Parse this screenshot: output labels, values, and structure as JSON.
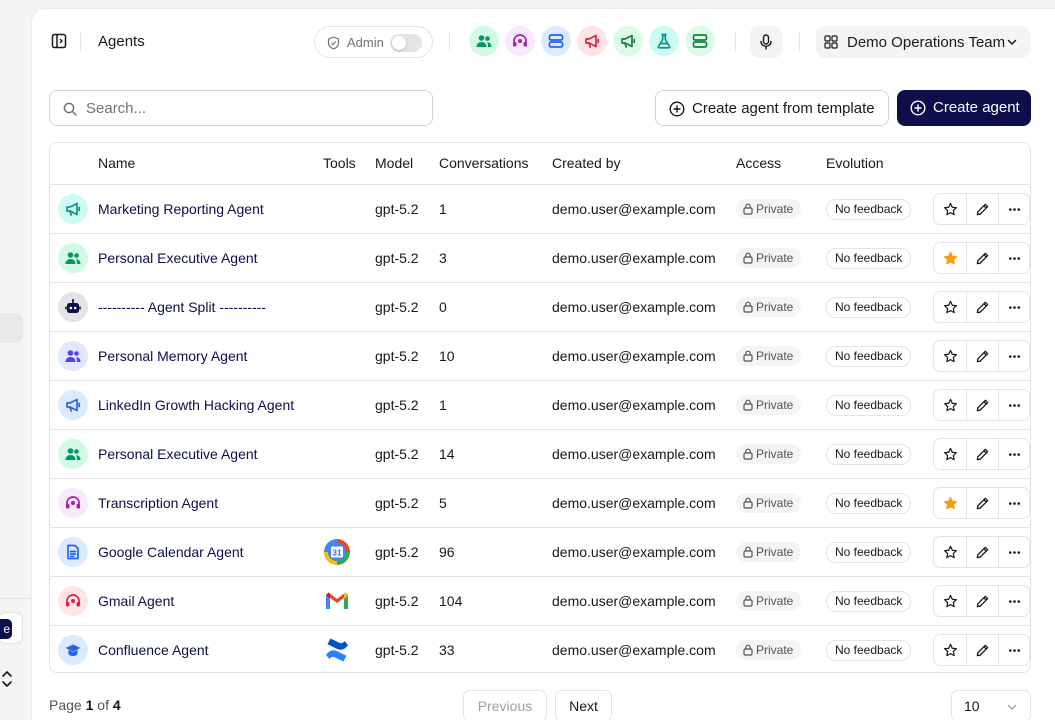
{
  "header": {
    "title": "Agents",
    "admin_label": "Admin",
    "admin_enabled": false,
    "team_name": "Demo Operations Team",
    "agent_shortcuts": [
      {
        "icon": "people-icon",
        "bg": "#d1fae5",
        "fg": "#059669"
      },
      {
        "icon": "headset-icon",
        "bg": "#fae8ff",
        "fg": "#a21caf"
      },
      {
        "icon": "server-icon",
        "bg": "#dbeafe",
        "fg": "#2563eb"
      },
      {
        "icon": "megaphone-icon",
        "bg": "#ffe4e6",
        "fg": "#e11d48"
      },
      {
        "icon": "megaphone-icon",
        "bg": "#dcfce7",
        "fg": "#15803d"
      },
      {
        "icon": "flask-icon",
        "bg": "#ccfbf1",
        "fg": "#0d9488"
      },
      {
        "icon": "server-icon",
        "bg": "#dcfce7",
        "fg": "#15803d"
      }
    ]
  },
  "toolbar": {
    "search_placeholder": "Search...",
    "template_button": "Create agent from template",
    "create_button": "Create agent"
  },
  "table": {
    "columns": {
      "name": "Name",
      "tools": "Tools",
      "model": "Model",
      "conversations": "Conversations",
      "created_by": "Created by",
      "access": "Access",
      "evolution": "Evolution"
    },
    "rows": [
      {
        "name": "Marketing Reporting Agent",
        "icon": "megaphone-icon",
        "icon_bg": "#ccfbf1",
        "icon_fg": "#0d9488",
        "tool": "",
        "model": "gpt-5.2",
        "conversations": "1",
        "created_by": "demo.user@example.com",
        "access": "Private",
        "evolution": "No feedback",
        "favorite": false
      },
      {
        "name": "Personal Executive Agent",
        "icon": "people-icon",
        "icon_bg": "#d1fae5",
        "icon_fg": "#059669",
        "tool": "",
        "model": "gpt-5.2",
        "conversations": "3",
        "created_by": "demo.user@example.com",
        "access": "Private",
        "evolution": "No feedback",
        "favorite": true
      },
      {
        "name": "---------- Agent Split ----------",
        "icon": "robot-icon",
        "icon_bg": "#e4e4e7",
        "icon_fg": "#0b0f4a",
        "tool": "",
        "model": "gpt-5.2",
        "conversations": "0",
        "created_by": "demo.user@example.com",
        "access": "Private",
        "evolution": "No feedback",
        "favorite": false
      },
      {
        "name": "Personal Memory Agent",
        "icon": "people-icon",
        "icon_bg": "#e0e7ff",
        "icon_fg": "#4f46e5",
        "tool": "",
        "model": "gpt-5.2",
        "conversations": "10",
        "created_by": "demo.user@example.com",
        "access": "Private",
        "evolution": "No feedback",
        "favorite": false
      },
      {
        "name": "LinkedIn Growth Hacking Agent",
        "icon": "megaphone-icon",
        "icon_bg": "#dbeafe",
        "icon_fg": "#2563eb",
        "tool": "",
        "model": "gpt-5.2",
        "conversations": "1",
        "created_by": "demo.user@example.com",
        "access": "Private",
        "evolution": "No feedback",
        "favorite": false
      },
      {
        "name": "Personal Executive Agent",
        "icon": "people-icon",
        "icon_bg": "#d1fae5",
        "icon_fg": "#059669",
        "tool": "",
        "model": "gpt-5.2",
        "conversations": "14",
        "created_by": "demo.user@example.com",
        "access": "Private",
        "evolution": "No feedback",
        "favorite": false
      },
      {
        "name": "Transcription Agent",
        "icon": "headset-icon",
        "icon_bg": "#fae8ff",
        "icon_fg": "#a21caf",
        "tool": "",
        "model": "gpt-5.2",
        "conversations": "5",
        "created_by": "demo.user@example.com",
        "access": "Private",
        "evolution": "No feedback",
        "favorite": true
      },
      {
        "name": "Google Calendar Agent",
        "icon": "document-icon",
        "icon_bg": "#dbeafe",
        "icon_fg": "#2563eb",
        "tool": "google-calendar-icon",
        "model": "gpt-5.2",
        "conversations": "96",
        "created_by": "demo.user@example.com",
        "access": "Private",
        "evolution": "No feedback",
        "favorite": false
      },
      {
        "name": "Gmail Agent",
        "icon": "headset-icon",
        "icon_bg": "#ffe4e6",
        "icon_fg": "#e11d48",
        "tool": "gmail-icon",
        "model": "gpt-5.2",
        "conversations": "104",
        "created_by": "demo.user@example.com",
        "access": "Private",
        "evolution": "No feedback",
        "favorite": false
      },
      {
        "name": "Confluence Agent",
        "icon": "graduation-cap-icon",
        "icon_bg": "#dbeafe",
        "icon_fg": "#2563eb",
        "tool": "confluence-icon",
        "model": "gpt-5.2",
        "conversations": "33",
        "created_by": "demo.user@example.com",
        "access": "Private",
        "evolution": "No feedback",
        "favorite": false
      }
    ]
  },
  "pagination": {
    "page_prefix": "Page",
    "current_page": "1",
    "of_label": "of",
    "total_pages": "4",
    "previous": "Previous",
    "next": "Next",
    "page_size": "10"
  },
  "sidebar": {
    "button_fragment": "e"
  },
  "colors": {
    "brand": "#0b0f4a",
    "star": "#f59e0b"
  }
}
